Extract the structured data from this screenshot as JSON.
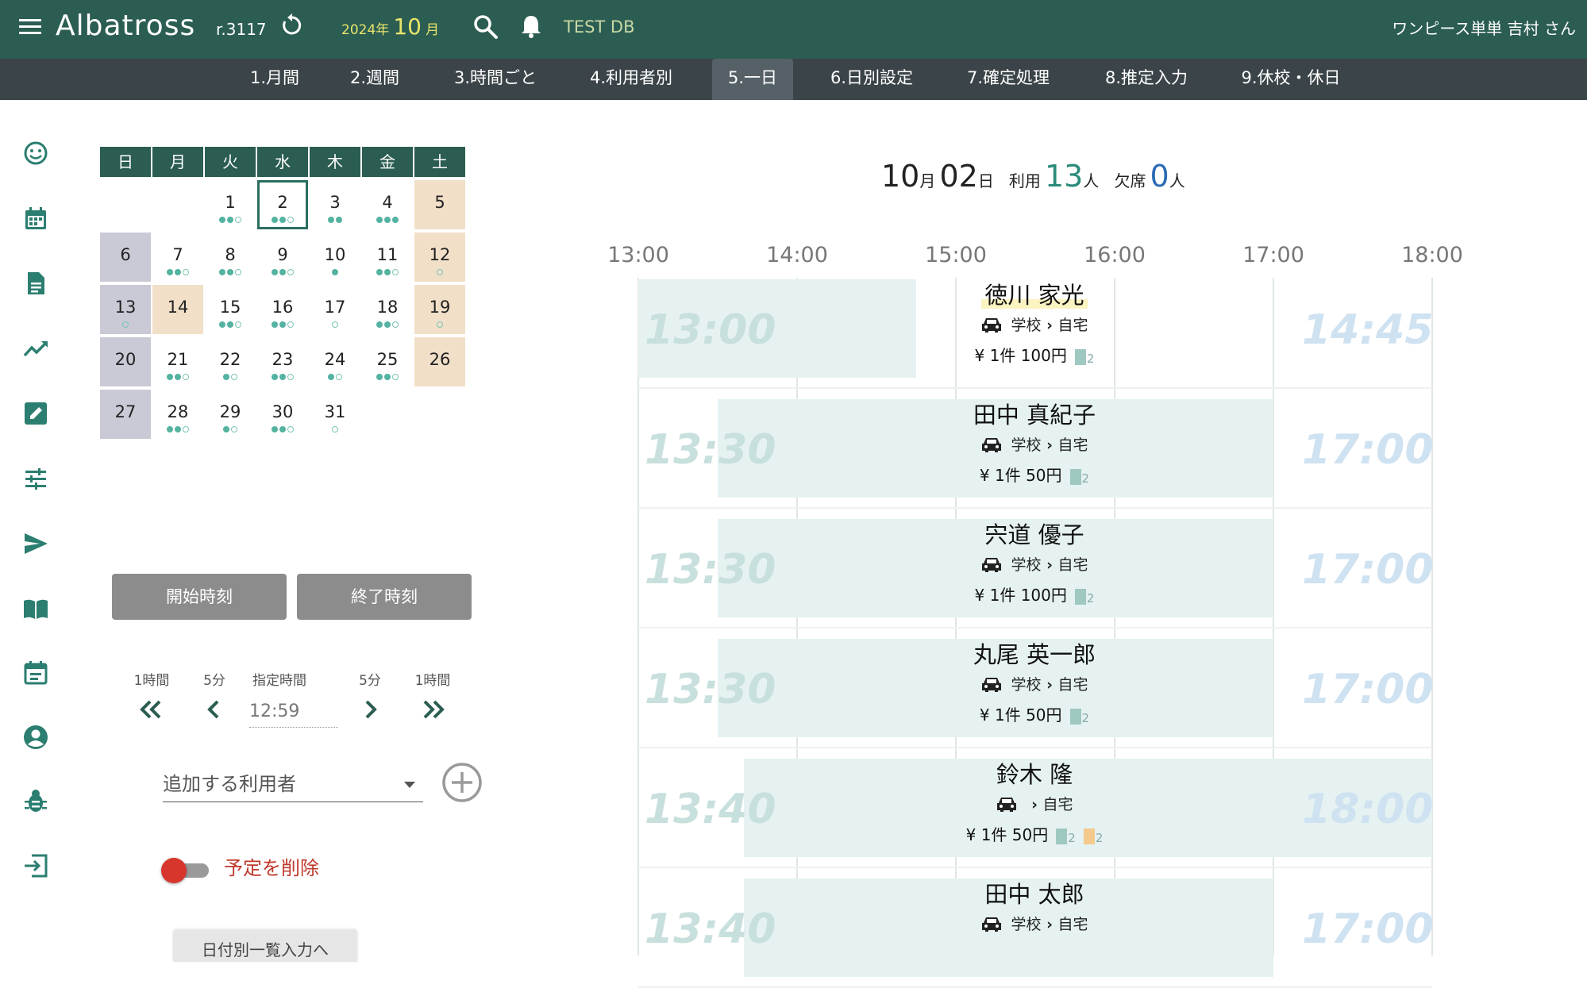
{
  "header": {
    "app_title": "Albatross",
    "version": "r.3117",
    "year_label": "2024年",
    "month_number": "10",
    "month_suffix": "月",
    "db_name": "TEST DB",
    "user_name": "ワンピース単単 吉村 さん"
  },
  "nav": {
    "tabs": [
      {
        "label": "1.月間"
      },
      {
        "label": "2.週間"
      },
      {
        "label": "3.時間ごと"
      },
      {
        "label": "4.利用者別"
      },
      {
        "label": "5.一日"
      },
      {
        "label": "6.日別設定"
      },
      {
        "label": "7.確定処理"
      },
      {
        "label": "8.推定入力"
      },
      {
        "label": "9.休校・休日"
      }
    ],
    "active_tab": "5.一日"
  },
  "sidebar": {
    "icons": [
      "smiley-icon",
      "calendar-icon",
      "document-icon",
      "trend-icon",
      "edit-icon",
      "tune-icon",
      "send-icon",
      "book-icon",
      "event-icon",
      "account-icon",
      "bug-icon",
      "logout-icon"
    ]
  },
  "calendar": {
    "weekdays": [
      "日",
      "月",
      "火",
      "水",
      "木",
      "金",
      "土"
    ],
    "weeks": [
      [
        null,
        null,
        {
          "d": "1",
          "dots": "ffe"
        },
        {
          "d": "2",
          "dots": "ffe",
          "selected": true
        },
        {
          "d": "3",
          "dots": "ff"
        },
        {
          "d": "4",
          "dots": "fff"
        },
        {
          "d": "5",
          "dots": ""
        }
      ],
      [
        {
          "d": "6",
          "dots": ""
        },
        {
          "d": "7",
          "dots": "ffe"
        },
        {
          "d": "8",
          "dots": "ffe"
        },
        {
          "d": "9",
          "dots": "ffe"
        },
        {
          "d": "10",
          "dots": "f"
        },
        {
          "d": "11",
          "dots": "ffe"
        },
        {
          "d": "12",
          "dots": "e"
        }
      ],
      [
        {
          "d": "13",
          "dots": "e"
        },
        {
          "d": "14",
          "dots": "",
          "holiday": true
        },
        {
          "d": "15",
          "dots": "ffe"
        },
        {
          "d": "16",
          "dots": "ffe"
        },
        {
          "d": "17",
          "dots": "e"
        },
        {
          "d": "18",
          "dots": "ffe"
        },
        {
          "d": "19",
          "dots": "e"
        }
      ],
      [
        {
          "d": "20",
          "dots": ""
        },
        {
          "d": "21",
          "dots": "ffe"
        },
        {
          "d": "22",
          "dots": "fe"
        },
        {
          "d": "23",
          "dots": "ffe"
        },
        {
          "d": "24",
          "dots": "fe"
        },
        {
          "d": "25",
          "dots": "ffe"
        },
        {
          "d": "26",
          "dots": ""
        }
      ],
      [
        {
          "d": "27",
          "dots": ""
        },
        {
          "d": "28",
          "dots": "ffe"
        },
        {
          "d": "29",
          "dots": "fe"
        },
        {
          "d": "30",
          "dots": "ffe"
        },
        {
          "d": "31",
          "dots": "e"
        },
        null,
        null
      ]
    ]
  },
  "controls": {
    "start_time_button": "開始時刻",
    "end_time_button": "終了時刻",
    "step_labels": [
      "1時間",
      "5分",
      "指定時間",
      "5分",
      "1時間"
    ],
    "time_value": "12:59",
    "user_select_placeholder": "追加する利用者",
    "delete_toggle_label": "予定を削除",
    "delete_toggle_on": false,
    "partial_button": "日付別一覧入力へ"
  },
  "summary": {
    "month": "10",
    "month_unit": "月",
    "day": "02",
    "day_unit": "日",
    "used_label": "利用",
    "used_count": "13",
    "used_unit": "人",
    "absent_label": "欠席",
    "absent_count": "0",
    "absent_unit": "人"
  },
  "timeline": {
    "hours": [
      "13:00",
      "14:00",
      "15:00",
      "16:00",
      "17:00",
      "18:00"
    ],
    "entries": [
      {
        "name": "徳川 家光",
        "start": "13:00",
        "end": "14:45",
        "route_from": "学校",
        "route_to": "自宅",
        "fee": "¥ 1件 100円",
        "badges": [
          {
            "n": "2",
            "color": "green"
          }
        ],
        "highlight": true
      },
      {
        "name": "田中 真紀子",
        "start": "13:30",
        "end": "17:00",
        "route_from": "学校",
        "route_to": "自宅",
        "fee": "¥ 1件 50円",
        "badges": [
          {
            "n": "2",
            "color": "green"
          }
        ]
      },
      {
        "name": "宍道 優子",
        "start": "13:30",
        "end": "17:00",
        "route_from": "学校",
        "route_to": "自宅",
        "fee": "¥ 1件 100円",
        "badges": [
          {
            "n": "2",
            "color": "green"
          }
        ]
      },
      {
        "name": "丸尾 英一郎",
        "start": "13:30",
        "end": "17:00",
        "route_from": "学校",
        "route_to": "自宅",
        "fee": "¥ 1件 50円",
        "badges": [
          {
            "n": "2",
            "color": "green"
          }
        ]
      },
      {
        "name": "鈴木 隆",
        "start": "13:40",
        "end": "18:00",
        "route_from": "",
        "route_to": "自宅",
        "fee": "¥ 1件 50円",
        "badges": [
          {
            "n": "2",
            "color": "green"
          },
          {
            "n": "2",
            "color": "orange"
          }
        ]
      },
      {
        "name": "田中 太郎",
        "start": "13:40",
        "end": "17:00",
        "route_from": "学校",
        "route_to": "自宅",
        "fee": "",
        "badges": []
      }
    ]
  }
}
